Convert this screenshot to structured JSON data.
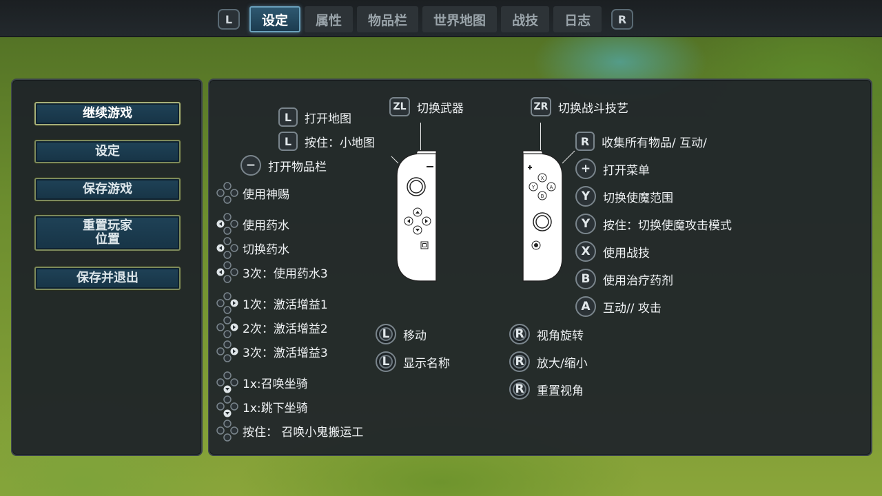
{
  "tabs": {
    "left_bumper": "L",
    "right_bumper": "R",
    "items": [
      {
        "label": "设定",
        "active": true
      },
      {
        "label": "属性",
        "active": false
      },
      {
        "label": "物品栏",
        "active": false
      },
      {
        "label": "世界地图",
        "active": false
      },
      {
        "label": "战技",
        "active": false
      },
      {
        "label": "日志",
        "active": false
      }
    ]
  },
  "menu": {
    "items": [
      {
        "label": "继续游戏"
      },
      {
        "label": "设定"
      },
      {
        "label": "保存游戏"
      },
      {
        "label": "重置玩家\n位置"
      },
      {
        "label": "保存并退出"
      }
    ]
  },
  "left_controls": [
    {
      "button": "L",
      "label": "打开地图",
      "icon": "L-button-icon"
    },
    {
      "button": "L",
      "label": "按住：小地图",
      "icon": "L-button-icon"
    },
    {
      "button": "−",
      "label": "打开物品栏",
      "icon": "minus-button-icon"
    },
    {
      "label": "使用神赐",
      "icon": "dpad-icon"
    },
    {
      "label": "使用药水",
      "icon": "dpad-left-icon"
    },
    {
      "label": "切换药水",
      "icon": "dpad-left-icon"
    },
    {
      "label": "3次：使用药水3",
      "icon": "dpad-left-icon"
    },
    {
      "label": "1次：激活增益1",
      "icon": "dpad-right-icon"
    },
    {
      "label": "2次：激活增益2",
      "icon": "dpad-right-icon"
    },
    {
      "label": "3次：激活增益3",
      "icon": "dpad-right-icon"
    },
    {
      "label": "1x:召唤坐骑",
      "icon": "dpad-down-icon"
    },
    {
      "label": "1x:跳下坐骑",
      "icon": "dpad-down-icon"
    },
    {
      "label": "按住： 召唤小鬼搬运工",
      "icon": "dpad-icon"
    }
  ],
  "center_controls": {
    "zl": {
      "button": "ZL",
      "label": "切换武器"
    },
    "zr": {
      "button": "ZR",
      "label": "切换战斗技艺"
    },
    "left_stick": [
      {
        "button": "L",
        "label": "移动"
      },
      {
        "button": "L",
        "label": "显示名称"
      }
    ],
    "right_stick": [
      {
        "button": "R",
        "label": "视角旋转"
      },
      {
        "button": "R",
        "label": "放大/缩小"
      },
      {
        "button": "R",
        "label": "重置视角"
      }
    ]
  },
  "right_controls": [
    {
      "button": "R",
      "label": "收集所有物品/ 互动/",
      "icon": "R-button-icon"
    },
    {
      "button": "+",
      "label": "打开菜单",
      "icon": "plus-button-icon"
    },
    {
      "button": "Y",
      "label": "切换使魔范围",
      "icon": "Y-button-icon"
    },
    {
      "button": "Y",
      "label": "按住：切换使魔攻击模式",
      "icon": "Y-button-icon"
    },
    {
      "button": "X",
      "label": "使用战技",
      "icon": "X-button-icon"
    },
    {
      "button": "B",
      "label": "使用治疗药剂",
      "icon": "B-button-icon"
    },
    {
      "button": "A",
      "label": "互动// 攻击",
      "icon": "A-button-icon"
    }
  ],
  "colors": {
    "panel_bg": "#21262a",
    "active_tab": "#2e5870",
    "menu_button": "#1f4257",
    "menu_border": "#7d8a5c"
  }
}
